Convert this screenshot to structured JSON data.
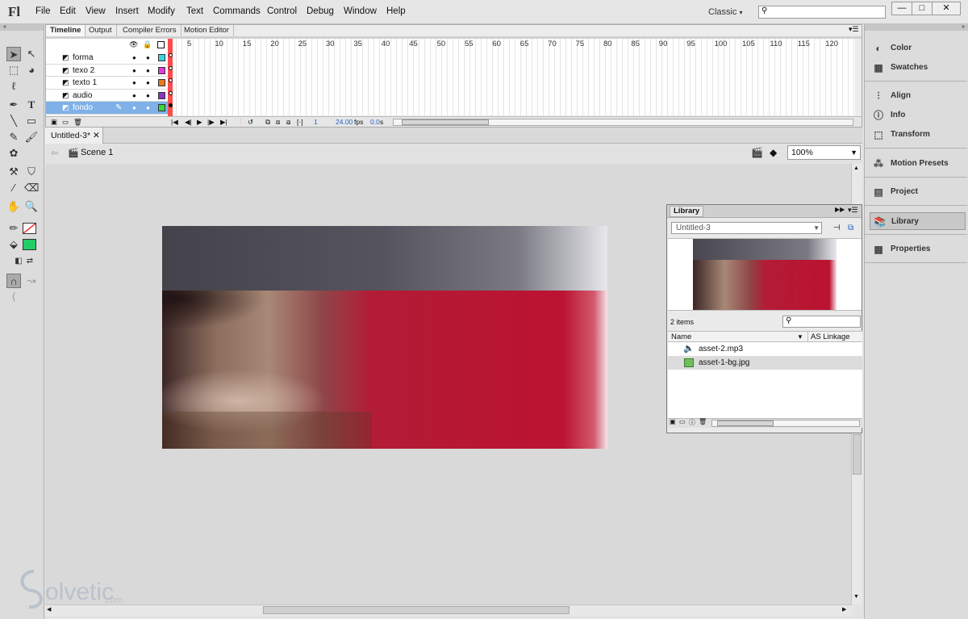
{
  "app": {
    "logo": "Fl",
    "workspace": "Classic",
    "win_min": "—",
    "win_max": "□",
    "win_close": "✕"
  },
  "menu": [
    "File",
    "Edit",
    "View",
    "Insert",
    "Modify",
    "Text",
    "Commands",
    "Control",
    "Debug",
    "Window",
    "Help"
  ],
  "timeline": {
    "tabs": [
      "Timeline",
      "Output",
      "Compiler Errors",
      "Motion Editor"
    ],
    "layers": [
      {
        "name": "forma",
        "color": "#3ad6e0"
      },
      {
        "name": "texo 2",
        "color": "#e43ad8"
      },
      {
        "name": "texto 1",
        "color": "#e8791c"
      },
      {
        "name": "audio",
        "color": "#8a36c2"
      },
      {
        "name": "fondo",
        "color": "#3bd63b",
        "selected": true
      }
    ],
    "frame_numbers": [
      "5",
      "10",
      "15",
      "20",
      "25",
      "30",
      "35",
      "40",
      "45",
      "50",
      "55",
      "60",
      "65",
      "70",
      "75",
      "80",
      "85",
      "90",
      "95",
      "100",
      "105",
      "110",
      "115",
      "120"
    ],
    "current_frame": "1",
    "fps": "24.00",
    "fps_unit": "fps",
    "time": "0.0",
    "time_unit": "s"
  },
  "document": {
    "tab": "Untitled-3*",
    "scene": "Scene 1",
    "zoom": "100%"
  },
  "library": {
    "title": "Library",
    "document": "Untitled-3",
    "count": "2 items",
    "col_name": "Name",
    "col_linkage": "AS Linkage",
    "items": [
      {
        "name": "asset-2.mp3",
        "icon": "sound-icon"
      },
      {
        "name": "asset-1-bg.jpg",
        "icon": "bitmap-icon",
        "selected": true
      }
    ]
  },
  "panels": [
    {
      "label": "Color",
      "icon": "color-icon"
    },
    {
      "label": "Swatches",
      "icon": "swatches-icon"
    },
    {
      "label": "Align",
      "icon": "align-icon"
    },
    {
      "label": "Info",
      "icon": "info-icon"
    },
    {
      "label": "Transform",
      "icon": "transform-icon"
    },
    {
      "label": "Motion Presets",
      "icon": "motion-presets-icon"
    },
    {
      "label": "Project",
      "icon": "project-icon"
    },
    {
      "label": "Library",
      "icon": "library-icon",
      "selected": true
    },
    {
      "label": "Properties",
      "icon": "properties-icon"
    }
  ],
  "watermark": {
    "main": "olvetic",
    "suffix": ".com"
  },
  "colors": {
    "stroke": "#ff3030",
    "fill": "#22cc66"
  }
}
